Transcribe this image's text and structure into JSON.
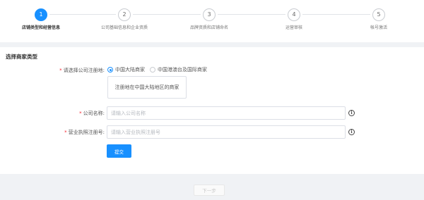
{
  "steps": [
    {
      "num": "1",
      "label": "店铺类型和经营信息"
    },
    {
      "num": "2",
      "label": "公司基础信息和企业资质"
    },
    {
      "num": "3",
      "label": "品牌资质和店铺命名"
    },
    {
      "num": "4",
      "label": "运营审核"
    },
    {
      "num": "5",
      "label": "帐号激活"
    }
  ],
  "form": {
    "section_title": "选择商家类型",
    "required_mark": "*",
    "register_location_label": "请选择公司注册地:",
    "radio_mainland": "中国大陆商家",
    "radio_hk_intl": "中国港澳台及国际商家",
    "tip_text": "注册地在中国大陆地区的商家",
    "company_name_label": "公司名称:",
    "company_name_placeholder": "请输入公司名称",
    "license_label": "营业执照注册号:",
    "license_placeholder": "请输入营业执照注册号",
    "info_icon_glyph": "i",
    "submit_label": "提交"
  },
  "footer": {
    "next_label": "下一步"
  },
  "colors": {
    "accent": "#1890ff",
    "required": "#f5222d"
  },
  "icons": [
    "info-icon",
    "radio-icon"
  ]
}
